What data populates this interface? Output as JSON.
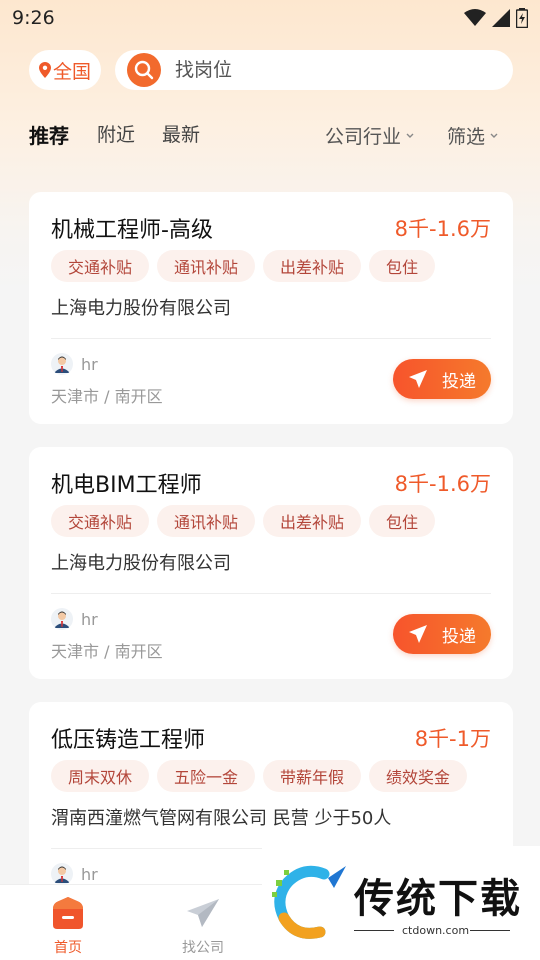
{
  "status_bar": {
    "time": "9:26"
  },
  "search": {
    "location_label": "全国",
    "placeholder": "找岗位"
  },
  "tabs": [
    {
      "label": "推荐",
      "active": true
    },
    {
      "label": "附近",
      "active": false
    },
    {
      "label": "最新",
      "active": false
    }
  ],
  "filters": {
    "industry": "公司行业",
    "filter": "筛选"
  },
  "jobs": [
    {
      "title": "机械工程师-高级",
      "salary": "8千-1.6万",
      "tags": [
        "交通补贴",
        "通讯补贴",
        "出差补贴",
        "包住"
      ],
      "company": "上海电力股份有限公司",
      "hr": "hr",
      "location": "天津市 / 南开区",
      "apply_label": "投递"
    },
    {
      "title": "机电BIM工程师",
      "salary": "8千-1.6万",
      "tags": [
        "交通补贴",
        "通讯补贴",
        "出差补贴",
        "包住"
      ],
      "company": "上海电力股份有限公司",
      "hr": "hr",
      "location": "天津市 / 南开区",
      "apply_label": "投递"
    },
    {
      "title": "低压铸造工程师",
      "salary": "8千-1万",
      "tags": [
        "周末双休",
        "五险一金",
        "带薪年假",
        "绩效奖金"
      ],
      "company": "渭南西潼燃气管网有限公司 民营 少于50人",
      "hr": "hr"
    }
  ],
  "bottom_nav": [
    {
      "label": "首页",
      "active": true
    },
    {
      "label": "找公司",
      "active": false
    }
  ],
  "watermark": {
    "title": "传统下载",
    "url": "ctdown.com"
  },
  "colors": {
    "accent": "#ef5a2a",
    "tag_bg": "#fcf1ed",
    "tag_text": "#b3463a"
  }
}
